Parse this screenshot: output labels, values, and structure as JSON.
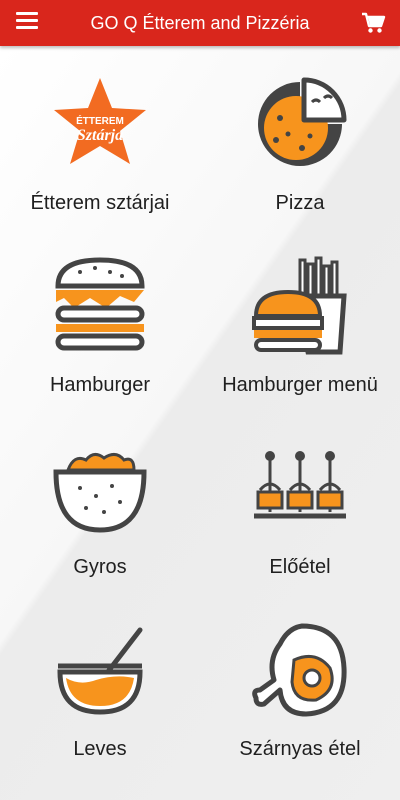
{
  "header": {
    "title": "GO Q Étterem and Pizzéria",
    "background": "#d9261c"
  },
  "colors": {
    "accent": "#f7941d",
    "outline": "#444444"
  },
  "categories": [
    {
      "label": "Étterem sztárjai",
      "icon": "star-badge-icon",
      "badge_line1": "ÉTTEREM",
      "badge_line2": "Sztárja"
    },
    {
      "label": "Pizza",
      "icon": "pizza-icon"
    },
    {
      "label": "Hamburger",
      "icon": "hamburger-icon"
    },
    {
      "label": "Hamburger menü",
      "icon": "burger-menu-icon"
    },
    {
      "label": "Gyros",
      "icon": "gyros-bowl-icon"
    },
    {
      "label": "Előétel",
      "icon": "skewer-appetizer-icon"
    },
    {
      "label": "Leves",
      "icon": "soup-bowl-icon"
    },
    {
      "label": "Szárnyas étel",
      "icon": "chicken-leg-icon"
    }
  ]
}
